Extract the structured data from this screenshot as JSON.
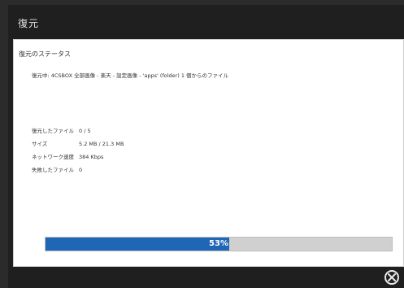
{
  "window": {
    "title": "復元"
  },
  "status": {
    "section_title": "復元のステータス",
    "restore_line": "復元中: 4CSBOX 全部画像 - 楽天 - 設定画像 - 'apps' (folder) 1 個からのファイル",
    "rows": [
      {
        "key": "復元したファイル",
        "value": "0 / 5"
      },
      {
        "key": "サイズ",
        "value": "5.2 MB / 21.3 MB"
      },
      {
        "key": "ネットワーク速度",
        "value": "384 Kbps"
      },
      {
        "key": "失敗したファイル",
        "value": "0"
      }
    ]
  },
  "progress": {
    "value": 0.53,
    "label": "53%",
    "fill_color": "#1f66b7"
  },
  "footer": {
    "close_icon": "close-icon"
  }
}
